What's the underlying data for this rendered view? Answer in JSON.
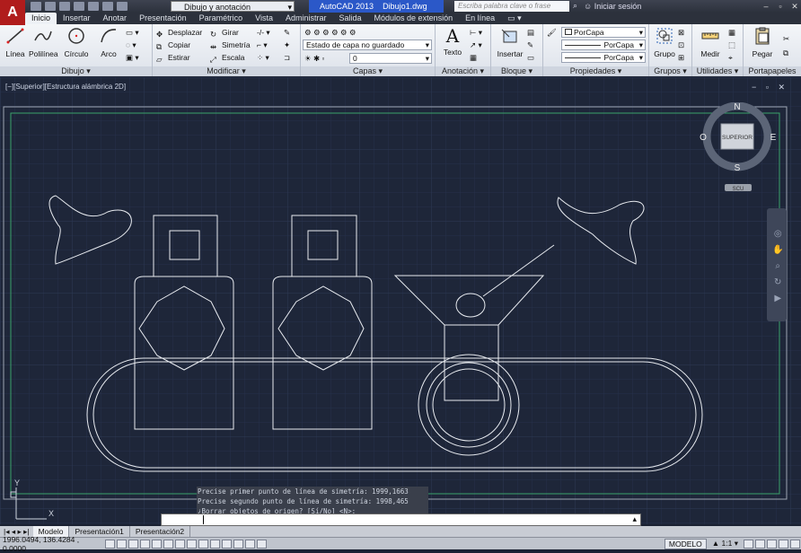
{
  "app": {
    "workspace": "Dibujo y anotación",
    "title_app": "AutoCAD 2013",
    "title_file": "Dibujo1.dwg",
    "search_placeholder": "Escriba palabra clave o frase",
    "login": "Iniciar sesión"
  },
  "ribbon_tabs": [
    "Inicio",
    "Insertar",
    "Anotar",
    "Presentación",
    "Paramétrico",
    "Vista",
    "Administrar",
    "Salida",
    "Módulos de extensión",
    "En línea"
  ],
  "panels": {
    "dibujo": {
      "title": "Dibujo",
      "line": "Línea",
      "polyline": "Polilínea",
      "circle": "Círculo",
      "arc": "Arco"
    },
    "modificar": {
      "title": "Modificar",
      "move": "Desplazar",
      "rotate": "Girar",
      "copy": "Copiar",
      "mirror": "Simetría",
      "stretch": "Estirar",
      "scale": "Escala"
    },
    "capas": {
      "title": "Capas",
      "state": "Estado de capa no guardado",
      "layer": "0"
    },
    "anotacion": {
      "title": "Anotación",
      "text": "Texto"
    },
    "bloque": {
      "title": "Bloque",
      "insert": "Insertar"
    },
    "propiedades": {
      "title": "Propiedades",
      "color": "PorCapa",
      "linetype": "PorCapa",
      "lineweight": "PorCapa"
    },
    "grupos": {
      "title": "Grupos",
      "group": "Grupo"
    },
    "utilidades": {
      "title": "Utilidades",
      "measure": "Medir"
    },
    "portapapeles": {
      "title": "Portapapeles",
      "paste": "Pegar"
    }
  },
  "viewport": {
    "label": "[−][Superior][Estructura alámbrica 2D]",
    "controls": "− ▫ ✕",
    "viewcube": {
      "face": "SUPERIOR",
      "n": "N",
      "s": "S",
      "e": "E",
      "w": "O",
      "wcs": "SCU"
    }
  },
  "command": {
    "history": [
      "Precise primer punto de línea de simetría: 1999,1663",
      "Precise segundo punto de línea de simetría: 1998,465",
      "¿Borrar objetos de origen? [Sí/No] <N>:"
    ],
    "prompt": ""
  },
  "layout_tabs": [
    "Modelo",
    "Presentación1",
    "Presentación2"
  ],
  "status": {
    "coords": "1996.0494, 136.4284 , 0.0000",
    "model": "MODELO",
    "scale": "1:1"
  },
  "colors": {
    "canvas": "#1e2639",
    "lines": "#e8ebf0",
    "accent": "#2b58c8"
  }
}
